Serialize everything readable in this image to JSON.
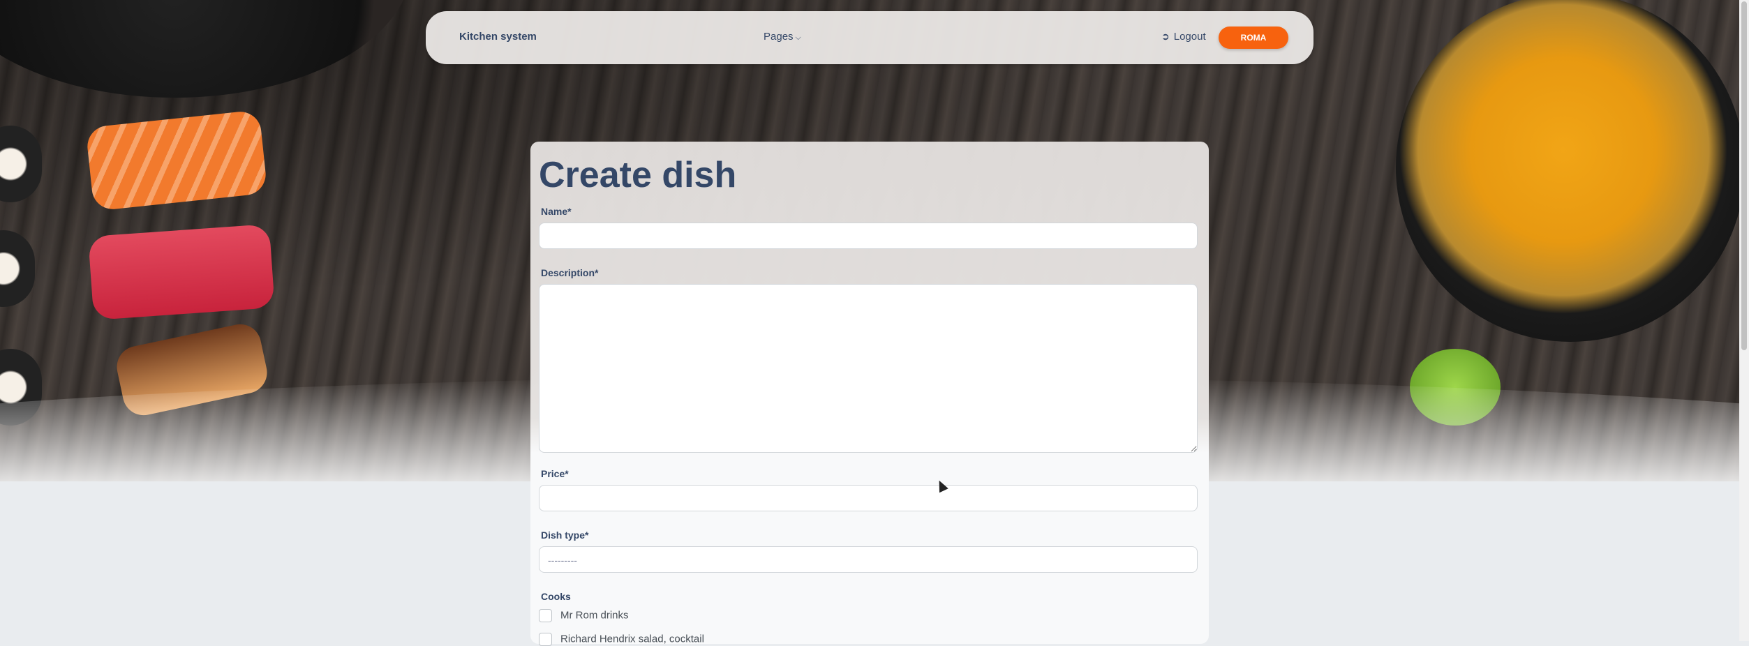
{
  "navbar": {
    "brand": "Kitchen system",
    "pages_label": "Pages",
    "logout_label": "Logout",
    "user_button": "ROMA"
  },
  "form": {
    "title": "Create dish",
    "name_label": "Name*",
    "name_value": "",
    "description_label": "Description*",
    "description_value": "",
    "price_label": "Price*",
    "price_value": "",
    "dish_type_label": "Dish type*",
    "dish_type_selected": "---------",
    "cooks_label": "Cooks",
    "cooks": [
      {
        "label": "Mr Rom drinks",
        "checked": false
      },
      {
        "label": "Richard Hendrix salad, cocktail",
        "checked": false
      }
    ]
  },
  "colors": {
    "accent": "#f7620e",
    "text": "#344767"
  }
}
